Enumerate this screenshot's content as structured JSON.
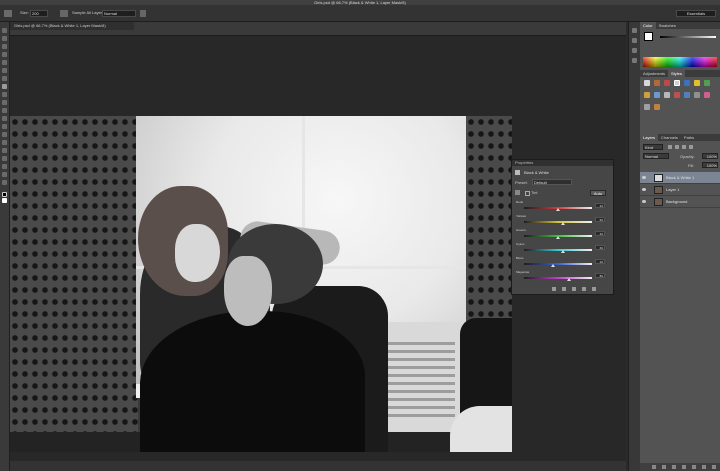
{
  "app": {
    "title": "Girls.psd @ 66.7% (Black & White 1, Layer Mask/8)",
    "tab_title": "Girls.psd @ 66.7% (Black & White 1, Layer Mask/8)"
  },
  "options_bar": {
    "tool_preset": "Brush tool",
    "size_label": "Size:",
    "size_value": "200",
    "mode_label": "Mode:",
    "mode_value": "Normal",
    "sample_label": "Sample All Layers",
    "workspace": "Essentials"
  },
  "properties": {
    "panel_title": "Properties",
    "adjustment_name": "Black & White",
    "preset_label": "Preset:",
    "preset_value": "Default",
    "tint_label": "Tint",
    "auto_label": "Auto",
    "rows": [
      {
        "label": "Reds",
        "value": "40",
        "color": "#d23b3b",
        "pos": 0.5
      },
      {
        "label": "Yellows",
        "value": "60",
        "color": "#d2c23b",
        "pos": 0.58
      },
      {
        "label": "Greens",
        "value": "40",
        "color": "#3fbf3f",
        "pos": 0.5
      },
      {
        "label": "Cyans",
        "value": "60",
        "color": "#3bc9cf",
        "pos": 0.58
      },
      {
        "label": "Blues",
        "value": "20",
        "color": "#3b5fd2",
        "pos": 0.42
      },
      {
        "label": "Magentas",
        "value": "80",
        "color": "#c43bd2",
        "pos": 0.66
      }
    ]
  },
  "dock": {
    "color_tabs": [
      "Color",
      "Swatches"
    ],
    "adjust_tabs": [
      "Adjustments",
      "Styles"
    ],
    "layer_tabs": [
      "Layers",
      "Channels",
      "Paths"
    ],
    "blend_mode": "Normal",
    "opacity_label": "Opacity:",
    "opacity_value": "100%",
    "fill_label": "Fill:",
    "fill_value": "100%",
    "layers": [
      {
        "name": "Black & White 1",
        "selected": true
      },
      {
        "name": "Layer 1",
        "selected": false
      },
      {
        "name": "Background",
        "selected": false
      }
    ]
  }
}
